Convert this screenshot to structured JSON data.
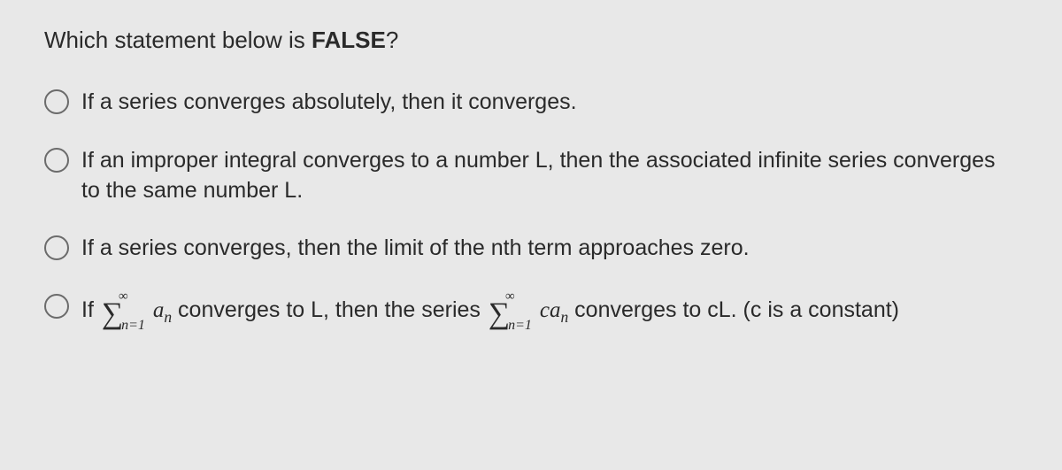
{
  "question": {
    "prefix": "Which statement below is ",
    "emph": "FALSE",
    "suffix": "?"
  },
  "options": {
    "a": "If a series converges absolutely, then it converges.",
    "b": "If an improper integral converges to a number L, then the associated infinite series converges to the same number L.",
    "c": "If a series converges, then the limit of the nth term approaches zero.",
    "d": {
      "p1": "If ",
      "sigma_top": "∞",
      "sigma_sub": "n=1",
      "term1_a": "a",
      "term1_sub": "n",
      "p2": " converges to L, then the series ",
      "term2_c": "ca",
      "term2_sub": "n",
      "p3": " converges to cL. (c is a constant)"
    }
  }
}
